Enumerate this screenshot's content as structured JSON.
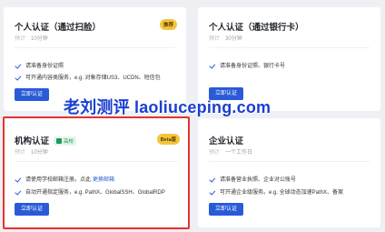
{
  "cards": {
    "face": {
      "title": "个人认证（通过扫脸）",
      "badge": "推荐",
      "time_label": "预计",
      "time": "10分钟",
      "items": [
        "请准备身份证照",
        "可开通内容类服务，e.g. 对象存储US3、UCDN、短信包"
      ],
      "button": "立即认证"
    },
    "bank": {
      "title": "个人认证（通过银行卡）",
      "time_label": "预计",
      "time": "30分钟",
      "items": [
        "请准备身份证照、银行卡号"
      ],
      "button": "立即认证"
    },
    "org": {
      "title": "机构认证",
      "tag": "高校",
      "badge": "Beta版",
      "time_label": "预计",
      "time": "10分钟",
      "items": [
        "请使用学校邮箱注册。点此",
        "自动开通指定服务，e.g. PathX、GlobalSSH、GlobalRDP"
      ],
      "link": "更换邮箱",
      "button": "立即认证"
    },
    "enterprise": {
      "title": "企业认证",
      "time_label": "预计",
      "time": "一个工作日",
      "items": [
        "请准备营业执照、企业对公账号",
        "可开通企业级服务。e.g. 全球动态加速PathX、备案"
      ],
      "button": "立即认证"
    }
  },
  "watermark": "老刘测评 laoliuceping.com",
  "colors": {
    "accent": "#2a5bd7",
    "badge": "#f4c53b",
    "highlight": "#e5322d",
    "tag": "#1a9d55"
  }
}
